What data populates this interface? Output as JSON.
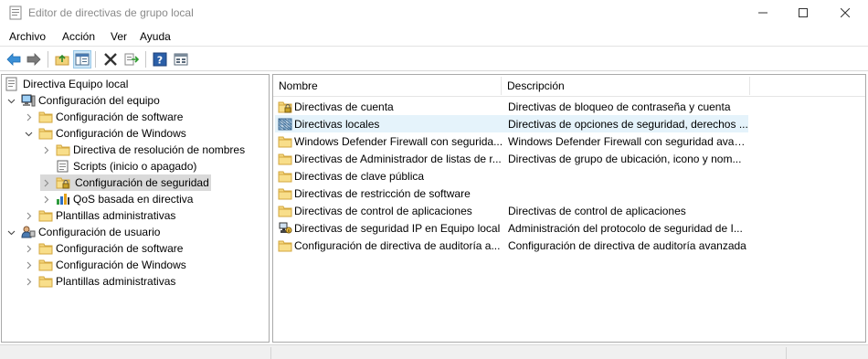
{
  "window": {
    "title": "Editor de directivas de grupo local"
  },
  "menu": [
    "Archivo",
    "Acción",
    "Ver",
    "Ayuda"
  ],
  "toolbar": {
    "buttons": [
      "back-icon",
      "forward-icon",
      "up-folder-icon",
      "show-hide-tree-icon",
      "delete-icon",
      "export-list-icon",
      "help-icon",
      "properties-icon"
    ]
  },
  "tree": {
    "root": "Directiva Equipo local",
    "items": [
      {
        "label": "Configuración del equipo",
        "level": 1,
        "expander": "expanded",
        "icon": "computer-icon"
      },
      {
        "label": "Configuración de software",
        "level": 2,
        "expander": "collapsed",
        "icon": "folder-icon"
      },
      {
        "label": "Configuración de Windows",
        "level": 2,
        "expander": "expanded",
        "icon": "folder-icon"
      },
      {
        "label": "Directiva de resolución de nombres",
        "level": 3,
        "expander": "collapsed",
        "icon": "folder-icon"
      },
      {
        "label": "Scripts (inicio o apagado)",
        "level": 3,
        "expander": "none",
        "icon": "script-icon"
      },
      {
        "label": "Configuración de seguridad",
        "level": 3,
        "expander": "collapsed",
        "icon": "security-folder-icon",
        "selected": true
      },
      {
        "label": "QoS basada en directiva",
        "level": 3,
        "expander": "collapsed",
        "icon": "qos-chart-icon"
      },
      {
        "label": "Plantillas administrativas",
        "level": 2,
        "expander": "collapsed",
        "icon": "folder-icon"
      },
      {
        "label": "Configuración de usuario",
        "level": 1,
        "expander": "expanded",
        "icon": "user-icon"
      },
      {
        "label": "Configuración de software",
        "level": 2,
        "expander": "collapsed",
        "icon": "folder-icon"
      },
      {
        "label": "Configuración de Windows",
        "level": 2,
        "expander": "collapsed",
        "icon": "folder-icon"
      },
      {
        "label": "Plantillas administrativas",
        "level": 2,
        "expander": "collapsed",
        "icon": "folder-icon"
      }
    ]
  },
  "list": {
    "columns": [
      "Nombre",
      "Descripción"
    ],
    "rows": [
      {
        "name": "Directivas de cuenta",
        "desc": "Directivas de bloqueo de contraseña y cuenta",
        "icon": "security-folder-icon"
      },
      {
        "name": "Directivas locales",
        "desc": "Directivas de opciones de seguridad, derechos ...",
        "icon": "local-policy-icon",
        "hover": true
      },
      {
        "name": "Windows Defender Firewall con segurida...",
        "desc": "Windows Defender Firewall con seguridad avanz...",
        "icon": "folder-icon"
      },
      {
        "name": "Directivas de Administrador de listas de r...",
        "desc": "Directivas de grupo de ubicación, icono y nom...",
        "icon": "folder-icon"
      },
      {
        "name": "Directivas de clave pública",
        "desc": "",
        "icon": "folder-icon"
      },
      {
        "name": "Directivas de restricción de software",
        "desc": "",
        "icon": "folder-icon"
      },
      {
        "name": "Directivas de control de aplicaciones",
        "desc": "Directivas de control de aplicaciones",
        "icon": "folder-icon"
      },
      {
        "name": "Directivas de seguridad IP en Equipo local",
        "desc": "Administración del protocolo de seguridad de I...",
        "icon": "ipsec-icon"
      },
      {
        "name": "Configuración de directiva de auditoría a...",
        "desc": "Configuración de directiva de auditoría avanzada",
        "icon": "folder-icon"
      }
    ]
  }
}
